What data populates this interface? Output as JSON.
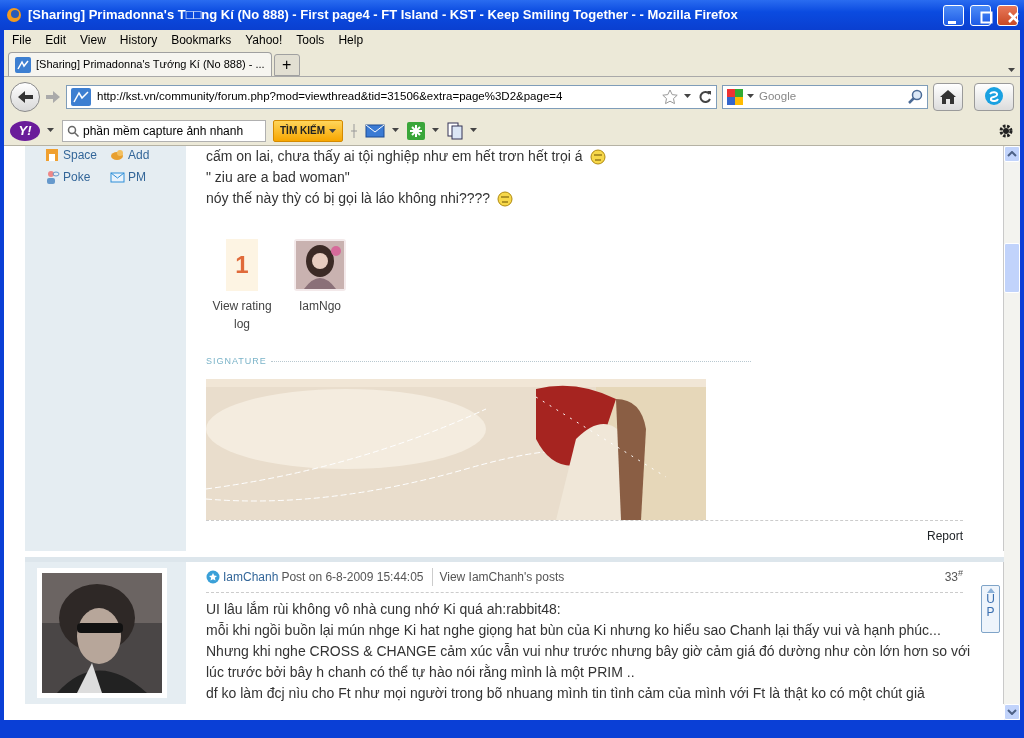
{
  "window": {
    "title": "[Sharing] Primadonna's T□□ng Kí (No 888) - First page4 - FT Island - KST - Keep Smiling Together - - Mozilla Firefox"
  },
  "menu": [
    "File",
    "Edit",
    "View",
    "History",
    "Bookmarks",
    "Yahoo!",
    "Tools",
    "Help"
  ],
  "tabs": [
    {
      "label": "[Sharing] Primadonna's Tướng Kí (No 888) - ...",
      "selected": true
    }
  ],
  "new_tab": "+",
  "address": {
    "url": "http://kst.vn/community/forum.php?mod=viewthread&tid=31506&extra=page%3D2&page=4"
  },
  "search": {
    "placeholder": "Google"
  },
  "yahoo": {
    "logo": "Y!",
    "query": "phần mềm capture ảnh nhanh",
    "button": "TÌM KIẾM"
  },
  "post1": {
    "links": [
      "Space",
      "Add",
      "Poke",
      "PM"
    ],
    "lines": [
      {
        "text": "cấm on lai, chưa thấy ai tội nghiệp như em hết trơn hết trọi á",
        "emoticon": true
      },
      {
        "text": "\" ziu are a bad woman\"",
        "emoticon": false
      },
      {
        "text": "nóy thế này thỳ có bị gọi là láo không nhi????",
        "emoticon": true
      }
    ],
    "rating": {
      "count": "1",
      "label": "View rating log"
    },
    "rater": "IamNgo",
    "signature_label": "SIGNATURE",
    "report": "Report"
  },
  "post2": {
    "author": "IamChanh",
    "posted": "Post on 6-8-2009 15:44:05",
    "view_posts": "View IamChanh's posts",
    "floor": "33",
    "floor_mark": "#",
    "lines": [
      "UI lâu lắm rùi không vô nhà cung nhớ Ki quá ah:rabbit48:",
      "mỗi khi ngồi buồn lại mún nhge Ki hat nghe giọng hat bùn của Ki nhưng ko hiểu sao Chanh lại thấy vui và hạnh phúc...",
      "Nhưng khi nghe CROSS & CHANGE cảm xúc vẫn vui như trước nhưng bây giờ cảm giá đó dường như còn lớn hơn so với",
      "lúc trước bởi bây h chanh có thể tự hào nói rằng mình là một PRIM ..",
      "df ko làm đcj nìu cho Ft như mọi người trong bõ nhuang mình tin tình cảm của mình với Ft là thật ko có một chút giả"
    ]
  },
  "up_button": "UP"
}
